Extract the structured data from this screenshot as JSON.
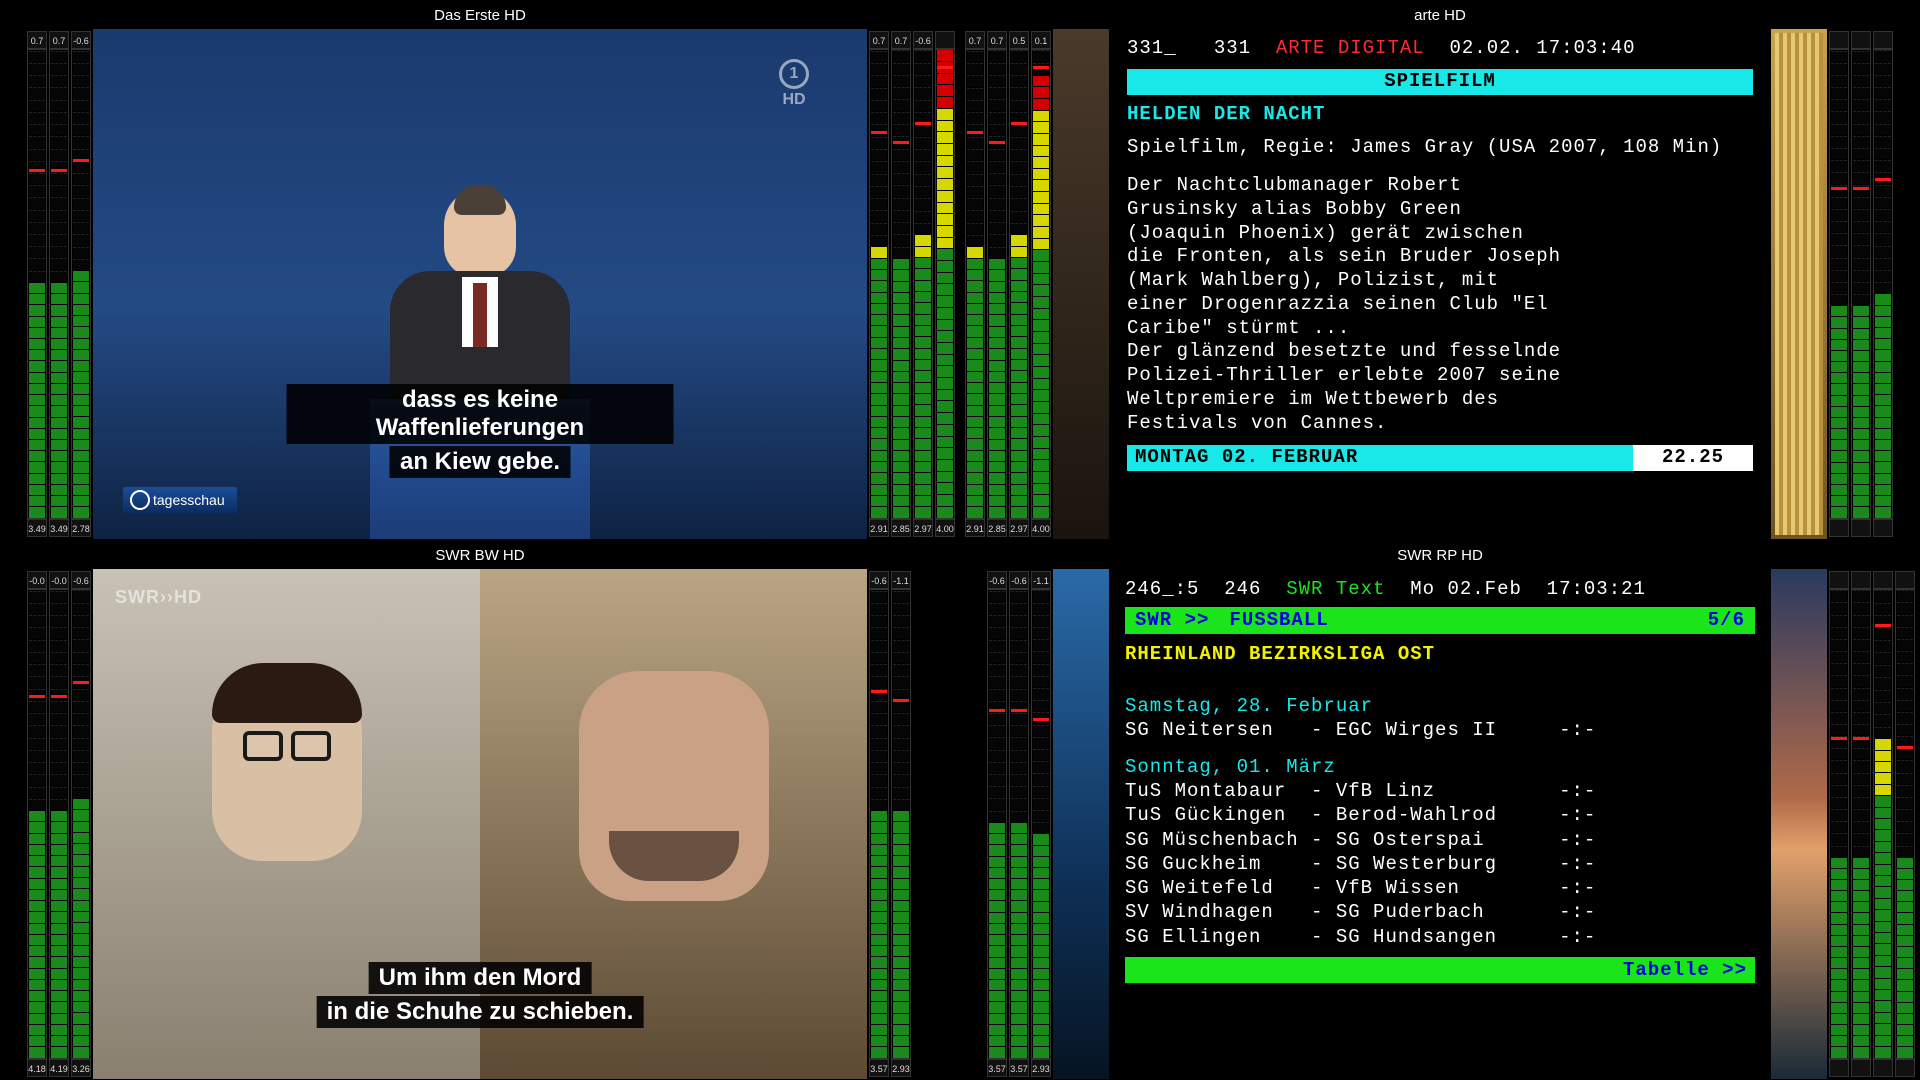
{
  "cells": [
    {
      "title": "Das Erste HD",
      "meters_left": {
        "top": [
          "0.7",
          "0.7",
          "-0.6"
        ],
        "bot": [
          "3.49",
          "3.49",
          "2.78"
        ],
        "level_pct": [
          52,
          52,
          54
        ]
      },
      "meters_right": {
        "top": [
          "0.7",
          "0.7",
          "-0.6"
        ],
        "bot": [
          "2.91",
          "2.85",
          "2.97",
          "4.00"
        ],
        "level_pct": [
          60,
          58,
          62,
          100
        ]
      },
      "bug_hd": "HD",
      "tagesschau": "tagesschau",
      "subtitle": [
        "dass es keine Waffenlieferungen",
        "an Kiew gebe."
      ]
    },
    {
      "title": "arte HD",
      "meters_left": {
        "top": [
          "0.7",
          "0.7",
          "0.5",
          "0.1"
        ],
        "bot": [
          "2.91",
          "2.85",
          "2.97",
          "4.00"
        ],
        "level_pct": [
          60,
          58,
          62,
          96
        ]
      },
      "meters_right": {
        "top": [
          "",
          "",
          ""
        ],
        "bot": [
          "",
          "",
          ""
        ],
        "level_pct": [
          48,
          48,
          50
        ]
      },
      "ttx": {
        "header_left": "331_   331",
        "header_brand": "ARTE DIGITAL",
        "header_right": "02.02. 17:03:40",
        "banner": "SPIELFILM",
        "title": "HELDEN DER NACHT",
        "subtitle_line": "Spielfilm, Regie: James Gray (USA 2007, 108 Min)",
        "body": "Der Nachtclubmanager Robert Grusinsky alias Bobby Green (Joaquin Phoenix) gerät zwischen die Fronten, als sein Bruder Joseph (Mark Wahlberg), Polizist, mit einer Drogenrazzia seinen Club \"El Caribe\" stürmt ...\nDer glänzend besetzte und fesselnde Polizei-Thriller erlebte 2007 seine Weltpremiere im Wettbewerb des Festivals von Cannes.",
        "foot_left": "MONTAG 02. FEBRUAR",
        "foot_right": "22.25"
      }
    },
    {
      "title": "SWR BW HD",
      "meters_left": {
        "top": [
          "-0.0",
          "-0.0",
          "-0.6"
        ],
        "bot": [
          "4.18",
          "4.19",
          "3.26"
        ],
        "level_pct": [
          55,
          55,
          58
        ]
      },
      "meters_right": {
        "top": [
          "-0.6",
          "-1.1"
        ],
        "bot": [
          "3.57",
          "2.93"
        ],
        "level_pct": [
          56,
          54
        ]
      },
      "bug": "SWR››HD",
      "subtitle": [
        "Um ihm den Mord",
        "in die Schuhe zu schieben."
      ]
    },
    {
      "title": "SWR RP HD",
      "meters_left": {
        "top": [
          "-0.6",
          "-0.6",
          "-1.1"
        ],
        "bot": [
          "3.57",
          "3.57",
          "2.93"
        ],
        "level_pct": [
          52,
          52,
          50
        ]
      },
      "meters_right": {
        "top": [
          "",
          "",
          "",
          ""
        ],
        "bot": [
          "",
          "",
          "",
          ""
        ],
        "level_pct": [
          46,
          46,
          70,
          44
        ]
      },
      "ttx": {
        "header_left": "246_:5  246",
        "header_brand": "SWR Text",
        "header_right": "Mo 02.Feb  17:03:21",
        "bar_left": "SWR >>",
        "bar_mid": "FUSSBALL",
        "bar_right": "5/6",
        "league": "RHEINLAND BEZIRKSLIGA OST",
        "day1": "Samstag, 28. Februar",
        "fixtures1": [
          {
            "h": "SG Neitersen",
            "a": "EGC Wirges II",
            "s": "-:-"
          }
        ],
        "day2": "Sonntag, 01. März",
        "fixtures2": [
          {
            "h": "TuS Montabaur",
            "a": "VfB Linz",
            "s": "-:-"
          },
          {
            "h": "TuS Gückingen",
            "a": "Berod-Wahlrod",
            "s": "-:-"
          },
          {
            "h": "SG Müschenbach",
            "a": "SG Osterspai",
            "s": "-:-"
          },
          {
            "h": "SG Guckheim",
            "a": "SG Westerburg",
            "s": "-:-"
          },
          {
            "h": "SG Weitefeld",
            "a": "VfB Wissen",
            "s": "-:-"
          },
          {
            "h": "SV Windhagen",
            "a": "SG Puderbach",
            "s": "-:-"
          },
          {
            "h": "SG Ellingen",
            "a": "SG Hundsangen",
            "s": "-:-"
          }
        ],
        "footer": "Tabelle >>"
      }
    }
  ]
}
